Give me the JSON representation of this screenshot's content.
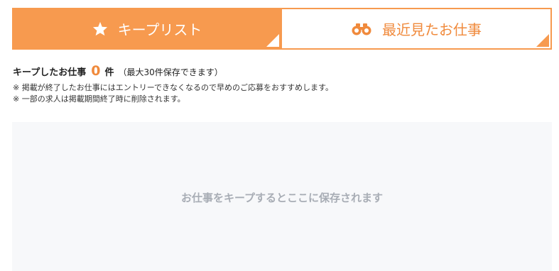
{
  "tabs": [
    {
      "label": "キープリスト",
      "icon": "star-icon",
      "active": true
    },
    {
      "label": "最近見たお仕事",
      "icon": "binoculars-icon",
      "active": false
    }
  ],
  "summary": {
    "title": "キープしたお仕事",
    "count": "0",
    "unit": "件",
    "limit": "（最大30件保存できます）",
    "notes": [
      "※ 掲載が終了したお仕事にはエントリーできなくなるので早めのご応募をおすすめします。",
      "※ 一部の求人は掲載期間終了時に削除されます。"
    ]
  },
  "empty_state": {
    "message": "お仕事をキープするとここに保存されます"
  },
  "colors": {
    "accent": "#f79a4f",
    "accent_text": "#f08a3c",
    "panel_bg": "#f7f8fa",
    "empty_text": "#a8adb5"
  }
}
